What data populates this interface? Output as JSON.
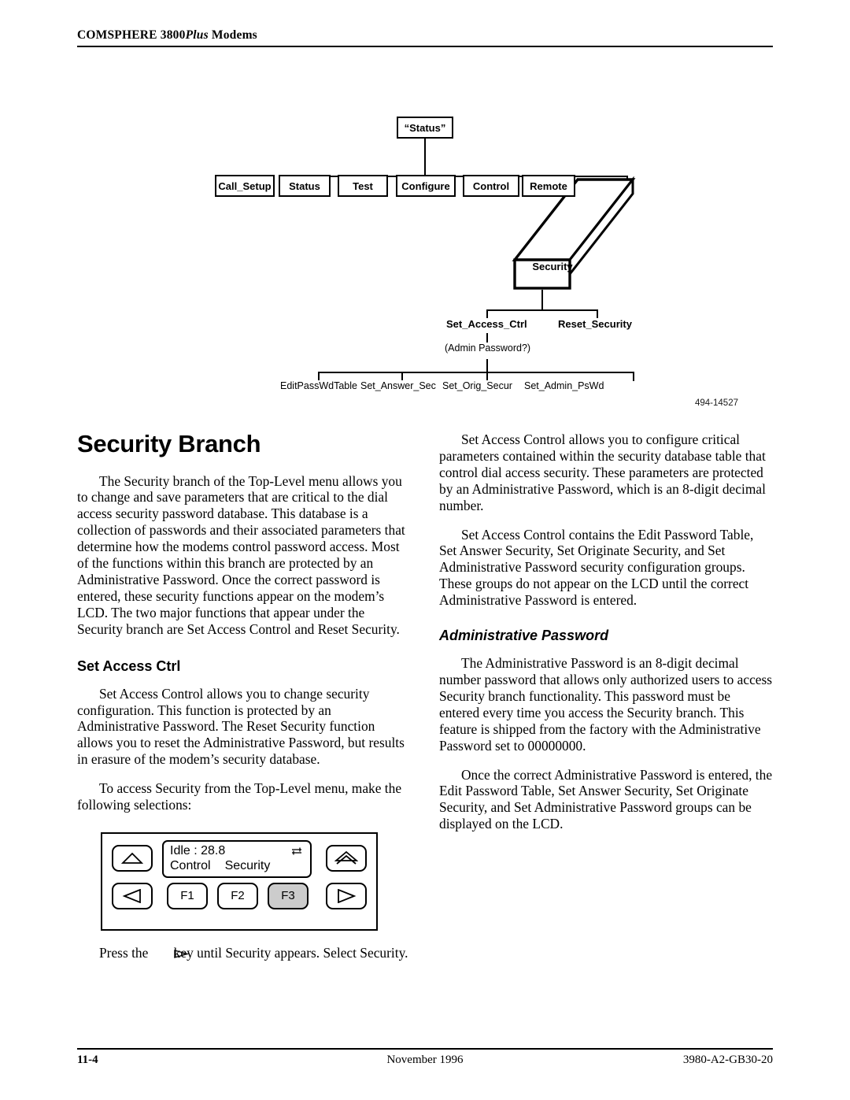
{
  "header": {
    "title_prefix": "COMSPHERE 3800",
    "title_italic": "Plus",
    "title_suffix": " Modems"
  },
  "figure": {
    "root_label": "“Status”",
    "level1": [
      "Call_Setup",
      "Status",
      "Test",
      "Configure",
      "Control",
      "Remote"
    ],
    "security_label": "Security",
    "security_children": [
      "Set_Access_Ctrl",
      "Reset_Security"
    ],
    "password_prompt": "(Admin Password?)",
    "access_children": [
      "EditPassWdTable",
      "Set_Answer_Sec",
      "Set_Orig_Secur",
      "Set_Admin_PsWd"
    ],
    "figure_id": "494-14527"
  },
  "left_column": {
    "chapter_title": "Security Branch",
    "intro_paragraph": "The Security branch of the Top-Level menu allows you to change and save parameters that are critical to the dial access security password database. This database is a collection of passwords and their associated parameters that determine how the modems control password access. Most of the functions within this branch are protected by an Administrative Password. Once the correct password is entered, these security functions appear on the modem’s LCD. The two major functions that appear under the Security branch are Set Access Control and Reset Security.",
    "section_title": "Set Access Ctrl",
    "paragraph_1": "Set Access Control allows you to change security configuration. This function is protected by an Administrative Password. The Reset Security function allows you to reset the Administrative Password, but results in erasure of the modem’s security database.",
    "paragraph_2": "To access Security from the Top-Level menu, make the following selections:",
    "press_key_prefix": "Press the",
    "press_key_suffix": "key until Security appears. Select Security."
  },
  "lcd_panel": {
    "line1": "Idle : 28.8",
    "line2_field1": "Control",
    "line2_field2": "Security",
    "status_icon": "data-transfer-arrows-icon",
    "key_up": "up-arrow-key",
    "key_left": "left-arrow-key",
    "key_right": "right-arrow-key",
    "key_select": "select-double-arrow-key",
    "function_keys": [
      "F1",
      "F2",
      "F3"
    ],
    "active_function_key": "F3",
    "highlight_color": "#cccccc"
  },
  "right_column": {
    "paragraph_1": "Set Access Control allows you to configure critical parameters contained within the security database table that control dial access security. These parameters are protected by an Administrative Password, which is an 8-digit decimal number.",
    "paragraph_2": "Set Access Control contains the Edit Password Table, Set Answer Security, Set Originate Security, and Set Administrative Password security configuration groups. These groups do not appear on the LCD until the correct Administrative Password is entered.",
    "subsection_title": "Administrative Password",
    "paragraph_3": "The Administrative Password is an 8-digit decimal number password that allows only authorized users to access Security branch functionality. This password must be entered every time you access the Security branch. This feature is shipped from the factory with the Administrative Password set to 00000000.",
    "paragraph_4": "Once the correct Administrative Password is entered, the Edit Password Table, Set Answer Security, Set Originate Security, and Set Administrative Password groups can be displayed on the LCD."
  },
  "footer": {
    "page_number": "11-4",
    "date": "November 1996",
    "doc_number": "3980-A2-GB30-20"
  }
}
